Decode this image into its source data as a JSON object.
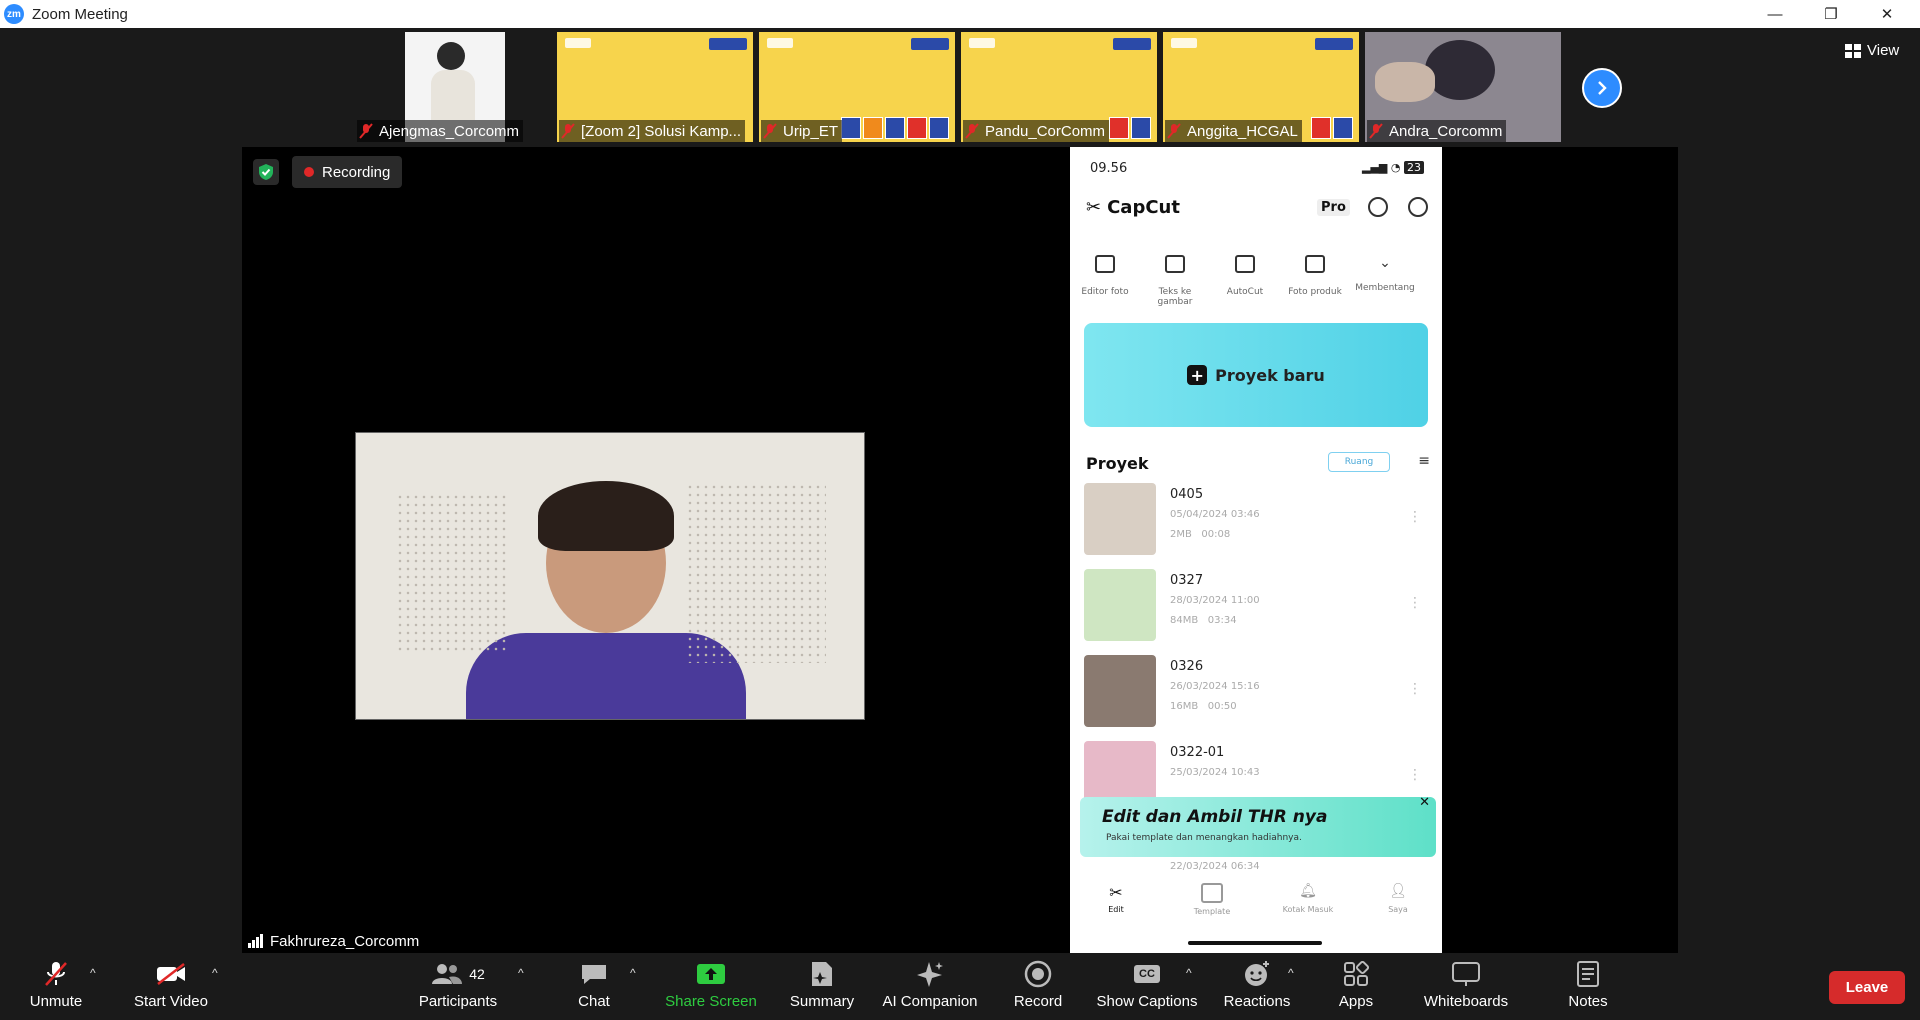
{
  "window": {
    "logo_text": "zm",
    "title": "Zoom Meeting",
    "minimize": "—",
    "restore": "❐",
    "close": "✕"
  },
  "participants_strip": [
    {
      "name": "Ajengmas_Corcomm",
      "kind": "video"
    },
    {
      "name": "[Zoom 2] Solusi Kamp...",
      "kind": "slide"
    },
    {
      "name": "Urip_ET",
      "kind": "slide"
    },
    {
      "name": "Pandu_CorComm",
      "kind": "slide"
    },
    {
      "name": "Anggita_HCGAL",
      "kind": "slide"
    },
    {
      "name": "Andra_Corcomm",
      "kind": "video"
    }
  ],
  "view_button": "View",
  "recording_label": "Recording",
  "speaker_name": "Fakhrureza_Corcomm",
  "phone": {
    "time": "09.56",
    "battery": "23",
    "app_name": "CapCut",
    "pro_label": "Pro",
    "tools": [
      "Editor foto",
      "Teks ke gambar",
      "AutoCut",
      "Foto produk",
      "Membentang"
    ],
    "new_project": "Proyek baru",
    "section_title": "Proyek",
    "space_label": "Ruang",
    "projects": [
      {
        "name": "0405",
        "date": "05/04/2024 03:46",
        "size": "2MB",
        "duration": "00:08"
      },
      {
        "name": "0327",
        "date": "28/03/2024 11:00",
        "size": "84MB",
        "duration": "03:34"
      },
      {
        "name": "0326",
        "date": "26/03/2024 15:16",
        "size": "16MB",
        "duration": "00:50"
      },
      {
        "name": "0322-01",
        "date": "25/03/2024 10:43",
        "size": "",
        "duration": ""
      }
    ],
    "banner_title": "Edit dan Ambil THR nya",
    "banner_sub": "Pakai template dan menangkan hadiahnya.",
    "banner_close": "✕",
    "hidden_date": "22/03/2024 06:34",
    "tabs": [
      "Edit",
      "Template",
      "Kotak Masuk",
      "Saya"
    ]
  },
  "toolbar": {
    "unmute": "Unmute",
    "start_video": "Start Video",
    "participants": "Participants",
    "participant_count": "42",
    "chat": "Chat",
    "share_screen": "Share Screen",
    "summary": "Summary",
    "ai_companion": "AI Companion",
    "record": "Record",
    "show_captions": "Show Captions",
    "captions_icon_text": "CC",
    "reactions": "Reactions",
    "apps": "Apps",
    "whiteboards": "Whiteboards",
    "notes": "Notes",
    "leave": "Leave",
    "caret": "^"
  },
  "colors": {
    "accent": "#2d8cff",
    "share_green": "#2ecc40",
    "leave_red": "#d62b2b",
    "recording_red": "#e02828"
  }
}
